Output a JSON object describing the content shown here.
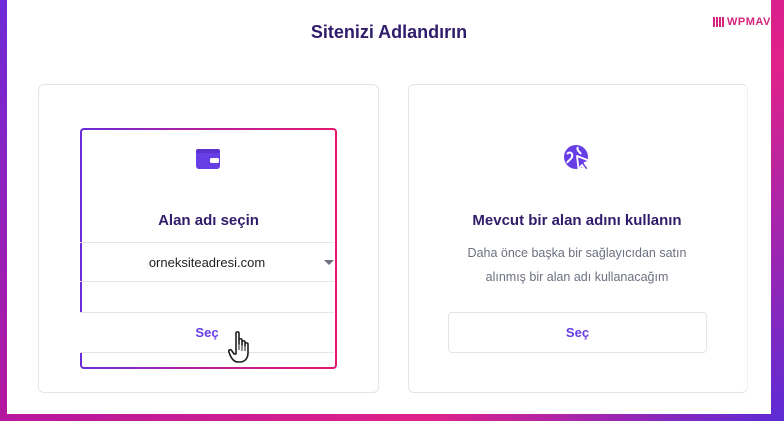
{
  "page": {
    "title": "Sitenizi Adlandırın",
    "watermark": "WPMAVI"
  },
  "left_card": {
    "icon": "wallet-icon",
    "heading": "Alan adı seçin",
    "domain_value": "orneksiteadresi.com",
    "button_label": "Seç"
  },
  "right_card": {
    "icon": "globe-cursor-icon",
    "heading": "Mevcut bir alan adını kullanın",
    "description_line1": "Daha önce başka bir sağlayıcıdan satın",
    "description_line2": "alınmış bir alan adı kullanacağım",
    "button_label": "Seç"
  },
  "colors": {
    "accent": "#673de6",
    "heading": "#2f1c6a",
    "highlight_start": "#6a2cd8",
    "highlight_end": "#e6186e",
    "watermark": "#d6247c"
  }
}
